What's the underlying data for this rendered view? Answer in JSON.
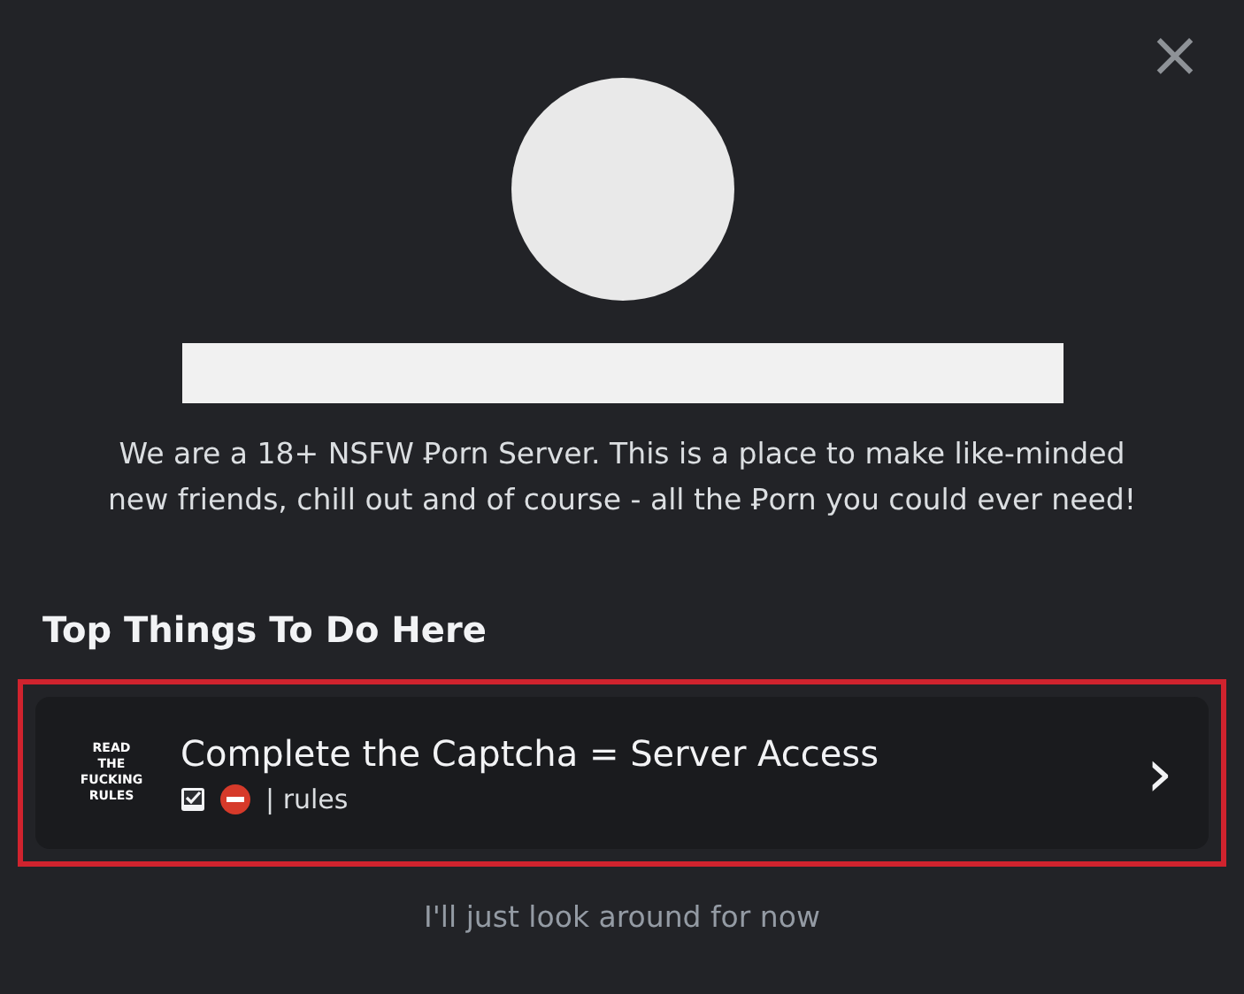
{
  "close_button": {
    "glyph": "×"
  },
  "server": {
    "avatar": {
      "kind": "redacted"
    },
    "name": {
      "kind": "redacted"
    },
    "description": "We are a 18+ NSFW Ꝑorn Server. This is a place to make like-minded new friends, chill out and of course - all the Ꝑorn you could ever need!"
  },
  "section_title": "Top Things To Do Here",
  "actions": [
    {
      "icon_lines": [
        "READ",
        "THE",
        "FUCKING",
        "RULES"
      ],
      "title": "Complete the Captcha = Server Access",
      "channel_separator": "|",
      "channel": "rules",
      "highlighted": true,
      "chevron": "›"
    }
  ],
  "skip_link": "I'll just look around for now"
}
